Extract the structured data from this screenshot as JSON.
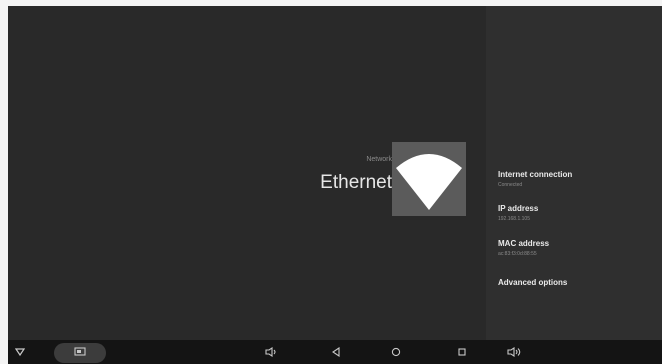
{
  "screen": {
    "section_label": "Network",
    "title": "Ethernet"
  },
  "details": [
    {
      "title": "Internet connection",
      "subtitle": "Connected"
    },
    {
      "title": "IP address",
      "subtitle": "192.168.1.105"
    },
    {
      "title": "MAC address",
      "subtitle": "ac:83:f3:0d:88:55"
    },
    {
      "title": "Advanced options",
      "subtitle": ""
    }
  ],
  "icons": {
    "header": "wifi-fan-icon",
    "nav": [
      "collapse-down-icon",
      "screenshot-icon",
      "volume-down-icon",
      "back-icon",
      "home-icon",
      "recents-icon",
      "volume-up-icon"
    ]
  },
  "colors": {
    "background": "#292929",
    "panel": "#2f2f2f",
    "icon_tile": "#5b5b5b",
    "navbar": "#141414"
  }
}
